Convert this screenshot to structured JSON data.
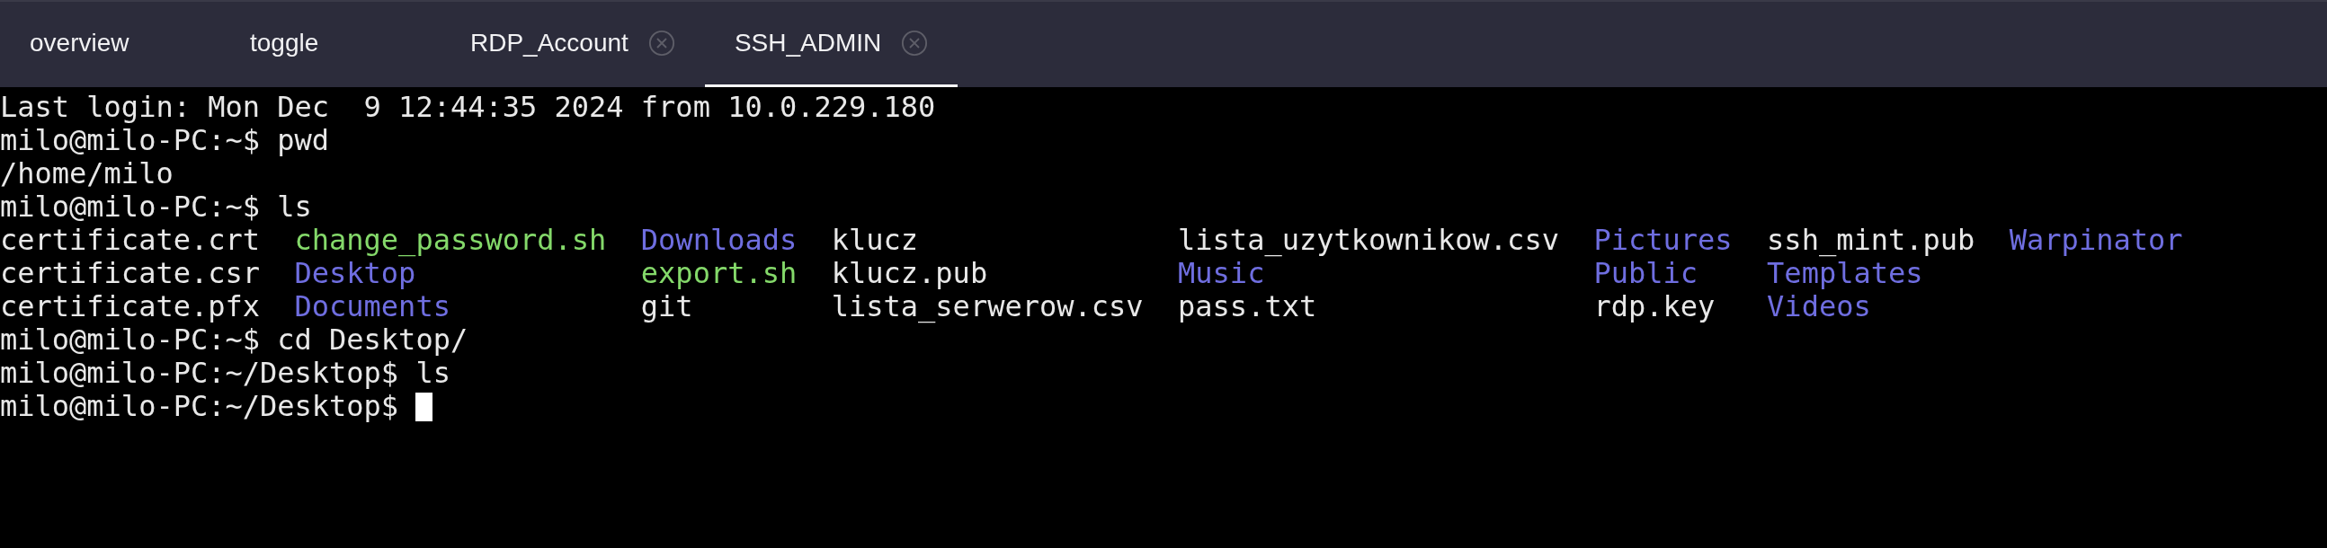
{
  "tabs": [
    {
      "label": "overview",
      "closable": false,
      "selected": false
    },
    {
      "label": "toggle",
      "closable": false,
      "selected": false
    },
    {
      "label": "RDP_Account",
      "closable": true,
      "selected": false
    },
    {
      "label": "SSH_ADMIN",
      "closable": true,
      "selected": true
    }
  ],
  "terminal": {
    "lines": [
      {
        "kind": "output",
        "text": "Last login: Mon Dec  9 12:44:35 2024 from 10.0.229.180"
      },
      {
        "kind": "output",
        "text": "milo@milo-PC:~$ pwd"
      },
      {
        "kind": "output",
        "text": "/home/milo"
      },
      {
        "kind": "output",
        "text": "milo@milo-PC:~$ ls"
      },
      {
        "kind": "listing",
        "columns": [
          [
            {
              "name": "certificate.crt",
              "kind": "file"
            },
            {
              "name": "certificate.csr",
              "kind": "file"
            },
            {
              "name": "certificate.pfx",
              "kind": "file"
            }
          ],
          [
            {
              "name": "change_password.sh",
              "kind": "executable"
            },
            {
              "name": "Desktop",
              "kind": "directory"
            },
            {
              "name": "Documents",
              "kind": "directory"
            }
          ],
          [
            {
              "name": "Downloads",
              "kind": "directory"
            },
            {
              "name": "export.sh",
              "kind": "executable"
            },
            {
              "name": "git",
              "kind": "file"
            }
          ],
          [
            {
              "name": "klucz",
              "kind": "file"
            },
            {
              "name": "klucz.pub",
              "kind": "file"
            },
            {
              "name": "lista_serwerow.csv",
              "kind": "file"
            }
          ],
          [
            {
              "name": "lista_uzytkownikow.csv",
              "kind": "file"
            },
            {
              "name": "Music",
              "kind": "directory"
            },
            {
              "name": "pass.txt",
              "kind": "file"
            }
          ],
          [
            {
              "name": "Pictures",
              "kind": "directory"
            },
            {
              "name": "Public",
              "kind": "directory"
            },
            {
              "name": "rdp.key",
              "kind": "file"
            }
          ],
          [
            {
              "name": "ssh_mint.pub",
              "kind": "file"
            },
            {
              "name": "Templates",
              "kind": "directory"
            },
            {
              "name": "Videos",
              "kind": "directory"
            }
          ],
          [
            {
              "name": "Warpinator",
              "kind": "directory"
            }
          ]
        ]
      },
      {
        "kind": "output",
        "text": "milo@milo-PC:~$ cd Desktop/"
      },
      {
        "kind": "output",
        "text": "milo@milo-PC:~/Desktop$ ls"
      },
      {
        "kind": "output",
        "text": "milo@milo-PC:~/Desktop$",
        "cursor": true
      }
    ]
  }
}
